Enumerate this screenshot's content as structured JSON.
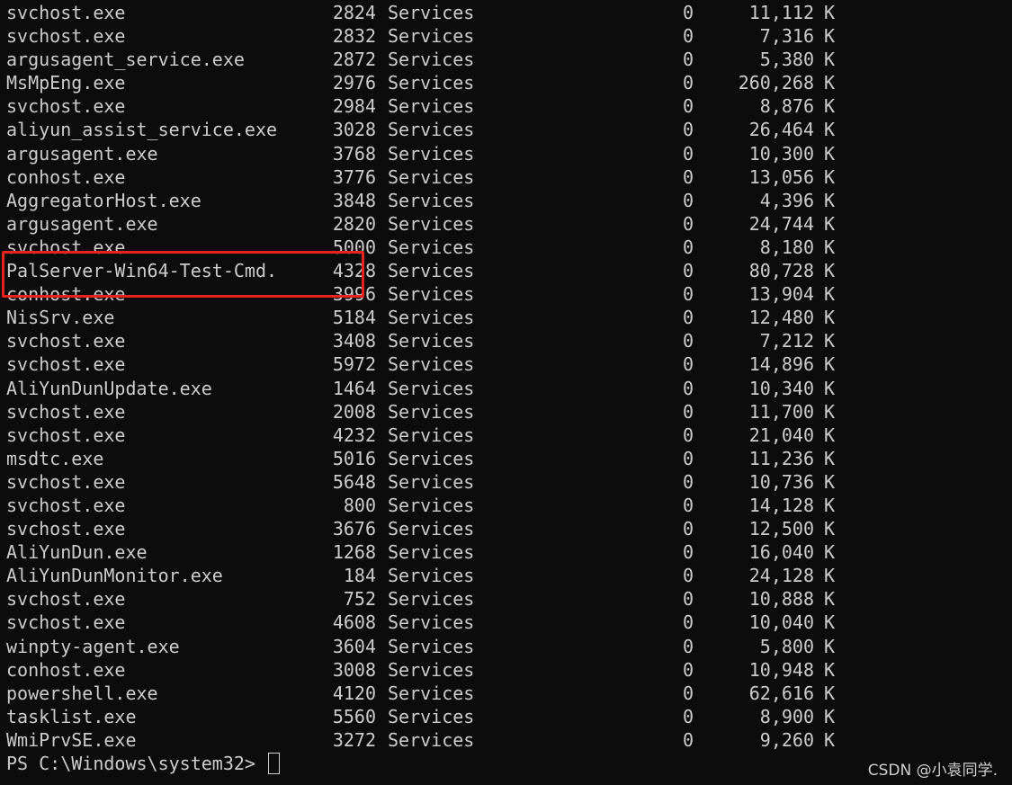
{
  "terminal": {
    "processes": [
      [
        "svchost.exe",
        "2824",
        "Services",
        "0",
        "11,112"
      ],
      [
        "svchost.exe",
        "2832",
        "Services",
        "0",
        "7,316"
      ],
      [
        "argusagent_service.exe",
        "2872",
        "Services",
        "0",
        "5,380"
      ],
      [
        "MsMpEng.exe",
        "2976",
        "Services",
        "0",
        "260,268"
      ],
      [
        "svchost.exe",
        "2984",
        "Services",
        "0",
        "8,876"
      ],
      [
        "aliyun_assist_service.exe",
        "3028",
        "Services",
        "0",
        "26,464"
      ],
      [
        "argusagent.exe",
        "3768",
        "Services",
        "0",
        "10,300"
      ],
      [
        "conhost.exe",
        "3776",
        "Services",
        "0",
        "13,056"
      ],
      [
        "AggregatorHost.exe",
        "3848",
        "Services",
        "0",
        "4,396"
      ],
      [
        "argusagent.exe",
        "2820",
        "Services",
        "0",
        "24,744"
      ],
      [
        "svchost.exe",
        "5000",
        "Services",
        "0",
        "8,180"
      ],
      [
        "PalServer-Win64-Test-Cmd.",
        "4328",
        "Services",
        "0",
        "80,728"
      ],
      [
        "conhost.exe",
        "3996",
        "Services",
        "0",
        "13,904"
      ],
      [
        "NisSrv.exe",
        "5184",
        "Services",
        "0",
        "12,480"
      ],
      [
        "svchost.exe",
        "3408",
        "Services",
        "0",
        "7,212"
      ],
      [
        "svchost.exe",
        "5972",
        "Services",
        "0",
        "14,896"
      ],
      [
        "AliYunDunUpdate.exe",
        "1464",
        "Services",
        "0",
        "10,340"
      ],
      [
        "svchost.exe",
        "2008",
        "Services",
        "0",
        "11,700"
      ],
      [
        "svchost.exe",
        "4232",
        "Services",
        "0",
        "21,040"
      ],
      [
        "msdtc.exe",
        "5016",
        "Services",
        "0",
        "11,236"
      ],
      [
        "svchost.exe",
        "5648",
        "Services",
        "0",
        "10,736"
      ],
      [
        "svchost.exe",
        "800",
        "Services",
        "0",
        "14,128"
      ],
      [
        "svchost.exe",
        "3676",
        "Services",
        "0",
        "12,500"
      ],
      [
        "AliYunDun.exe",
        "1268",
        "Services",
        "0",
        "16,040"
      ],
      [
        "AliYunDunMonitor.exe",
        "184",
        "Services",
        "0",
        "24,128"
      ],
      [
        "svchost.exe",
        "752",
        "Services",
        "0",
        "10,888"
      ],
      [
        "svchost.exe",
        "4608",
        "Services",
        "0",
        "10,040"
      ],
      [
        "winpty-agent.exe",
        "3604",
        "Services",
        "0",
        "5,800"
      ],
      [
        "conhost.exe",
        "3008",
        "Services",
        "0",
        "10,948"
      ],
      [
        "powershell.exe",
        "4120",
        "Services",
        "0",
        "62,616"
      ],
      [
        "tasklist.exe",
        "5560",
        "Services",
        "0",
        "8,900"
      ],
      [
        "WmiPrvSE.exe",
        "3272",
        "Services",
        "0",
        "9,260"
      ]
    ],
    "mem_unit": "K",
    "prompt": "PS C:\\Windows\\system32> ",
    "highlighted_process": "PalServer-Win64-Test-Cmd."
  },
  "watermark": "CSDN @小袁同学.",
  "colors": {
    "background": "#0c0c0c",
    "text": "#cccccc",
    "highlight": "#e8231f"
  }
}
